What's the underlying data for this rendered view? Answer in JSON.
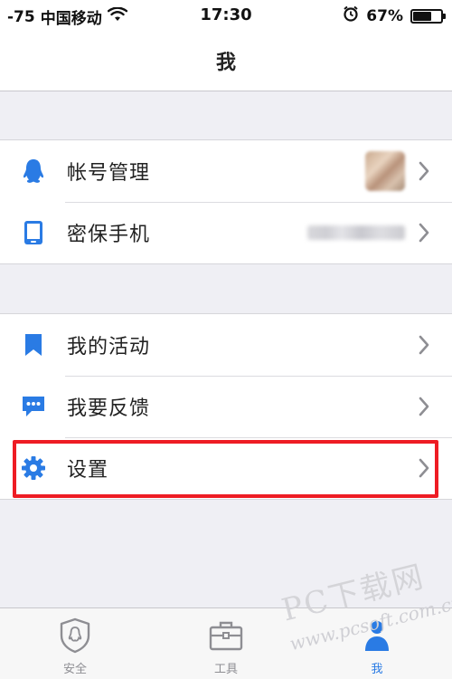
{
  "status_bar": {
    "signal": "-75",
    "carrier": "中国移动",
    "time": "17:30",
    "battery_percent_label": "67%",
    "battery_level": 0.67
  },
  "nav": {
    "title": "我"
  },
  "sections": {
    "account": {
      "items": [
        {
          "label": "帐号管理",
          "icon": "qq-penguin-icon"
        },
        {
          "label": "密保手机",
          "icon": "phone-icon"
        }
      ]
    },
    "more": {
      "items": [
        {
          "label": "我的活动",
          "icon": "bookmark-icon"
        },
        {
          "label": "我要反馈",
          "icon": "chat-bubble-icon"
        },
        {
          "label": "设置",
          "icon": "gear-icon"
        }
      ]
    }
  },
  "tabs": [
    {
      "label": "安全",
      "icon": "shield-penguin-icon"
    },
    {
      "label": "工具",
      "icon": "toolbox-icon"
    },
    {
      "label": "我",
      "icon": "person-icon",
      "active": true
    }
  ],
  "watermark": {
    "brand": "PC下载网",
    "url": "www.pcsoft.com.cn"
  },
  "colors": {
    "accent": "#2a7be4",
    "highlight": "#ee1c24",
    "background": "#efeff4"
  }
}
